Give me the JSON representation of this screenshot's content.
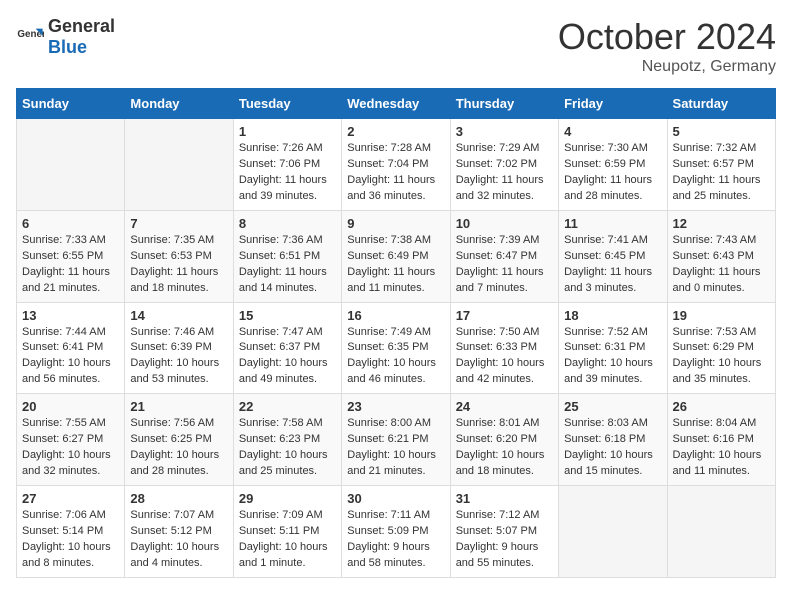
{
  "header": {
    "logo_general": "General",
    "logo_blue": "Blue",
    "month": "October 2024",
    "location": "Neupotz, Germany"
  },
  "days_of_week": [
    "Sunday",
    "Monday",
    "Tuesday",
    "Wednesday",
    "Thursday",
    "Friday",
    "Saturday"
  ],
  "weeks": [
    [
      {
        "day": "",
        "empty": true
      },
      {
        "day": "",
        "empty": true
      },
      {
        "day": "1",
        "sunrise": "7:26 AM",
        "sunset": "7:06 PM",
        "daylight": "11 hours and 39 minutes."
      },
      {
        "day": "2",
        "sunrise": "7:28 AM",
        "sunset": "7:04 PM",
        "daylight": "11 hours and 36 minutes."
      },
      {
        "day": "3",
        "sunrise": "7:29 AM",
        "sunset": "7:02 PM",
        "daylight": "11 hours and 32 minutes."
      },
      {
        "day": "4",
        "sunrise": "7:30 AM",
        "sunset": "6:59 PM",
        "daylight": "11 hours and 28 minutes."
      },
      {
        "day": "5",
        "sunrise": "7:32 AM",
        "sunset": "6:57 PM",
        "daylight": "11 hours and 25 minutes."
      }
    ],
    [
      {
        "day": "6",
        "sunrise": "7:33 AM",
        "sunset": "6:55 PM",
        "daylight": "11 hours and 21 minutes."
      },
      {
        "day": "7",
        "sunrise": "7:35 AM",
        "sunset": "6:53 PM",
        "daylight": "11 hours and 18 minutes."
      },
      {
        "day": "8",
        "sunrise": "7:36 AM",
        "sunset": "6:51 PM",
        "daylight": "11 hours and 14 minutes."
      },
      {
        "day": "9",
        "sunrise": "7:38 AM",
        "sunset": "6:49 PM",
        "daylight": "11 hours and 11 minutes."
      },
      {
        "day": "10",
        "sunrise": "7:39 AM",
        "sunset": "6:47 PM",
        "daylight": "11 hours and 7 minutes."
      },
      {
        "day": "11",
        "sunrise": "7:41 AM",
        "sunset": "6:45 PM",
        "daylight": "11 hours and 3 minutes."
      },
      {
        "day": "12",
        "sunrise": "7:43 AM",
        "sunset": "6:43 PM",
        "daylight": "11 hours and 0 minutes."
      }
    ],
    [
      {
        "day": "13",
        "sunrise": "7:44 AM",
        "sunset": "6:41 PM",
        "daylight": "10 hours and 56 minutes."
      },
      {
        "day": "14",
        "sunrise": "7:46 AM",
        "sunset": "6:39 PM",
        "daylight": "10 hours and 53 minutes."
      },
      {
        "day": "15",
        "sunrise": "7:47 AM",
        "sunset": "6:37 PM",
        "daylight": "10 hours and 49 minutes."
      },
      {
        "day": "16",
        "sunrise": "7:49 AM",
        "sunset": "6:35 PM",
        "daylight": "10 hours and 46 minutes."
      },
      {
        "day": "17",
        "sunrise": "7:50 AM",
        "sunset": "6:33 PM",
        "daylight": "10 hours and 42 minutes."
      },
      {
        "day": "18",
        "sunrise": "7:52 AM",
        "sunset": "6:31 PM",
        "daylight": "10 hours and 39 minutes."
      },
      {
        "day": "19",
        "sunrise": "7:53 AM",
        "sunset": "6:29 PM",
        "daylight": "10 hours and 35 minutes."
      }
    ],
    [
      {
        "day": "20",
        "sunrise": "7:55 AM",
        "sunset": "6:27 PM",
        "daylight": "10 hours and 32 minutes."
      },
      {
        "day": "21",
        "sunrise": "7:56 AM",
        "sunset": "6:25 PM",
        "daylight": "10 hours and 28 minutes."
      },
      {
        "day": "22",
        "sunrise": "7:58 AM",
        "sunset": "6:23 PM",
        "daylight": "10 hours and 25 minutes."
      },
      {
        "day": "23",
        "sunrise": "8:00 AM",
        "sunset": "6:21 PM",
        "daylight": "10 hours and 21 minutes."
      },
      {
        "day": "24",
        "sunrise": "8:01 AM",
        "sunset": "6:20 PM",
        "daylight": "10 hours and 18 minutes."
      },
      {
        "day": "25",
        "sunrise": "8:03 AM",
        "sunset": "6:18 PM",
        "daylight": "10 hours and 15 minutes."
      },
      {
        "day": "26",
        "sunrise": "8:04 AM",
        "sunset": "6:16 PM",
        "daylight": "10 hours and 11 minutes."
      }
    ],
    [
      {
        "day": "27",
        "sunrise": "7:06 AM",
        "sunset": "5:14 PM",
        "daylight": "10 hours and 8 minutes."
      },
      {
        "day": "28",
        "sunrise": "7:07 AM",
        "sunset": "5:12 PM",
        "daylight": "10 hours and 4 minutes."
      },
      {
        "day": "29",
        "sunrise": "7:09 AM",
        "sunset": "5:11 PM",
        "daylight": "10 hours and 1 minute."
      },
      {
        "day": "30",
        "sunrise": "7:11 AM",
        "sunset": "5:09 PM",
        "daylight": "9 hours and 58 minutes."
      },
      {
        "day": "31",
        "sunrise": "7:12 AM",
        "sunset": "5:07 PM",
        "daylight": "9 hours and 55 minutes."
      },
      {
        "day": "",
        "empty": true
      },
      {
        "day": "",
        "empty": true
      }
    ]
  ]
}
